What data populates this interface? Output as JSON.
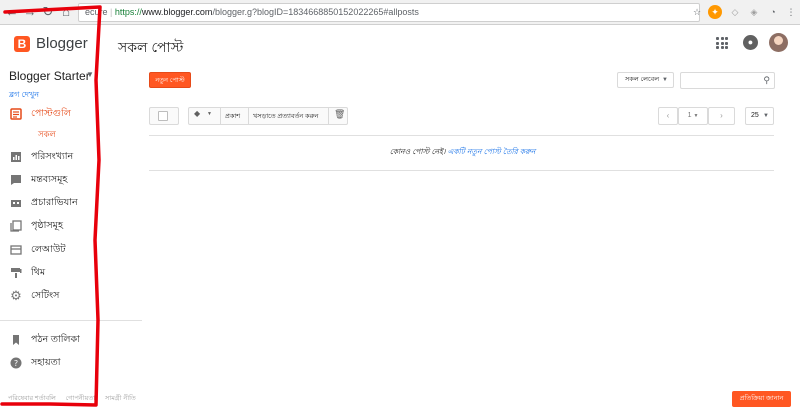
{
  "browser": {
    "secure_label": "ecure",
    "url_scheme": "https://",
    "url_host": "www.blogger.com",
    "url_rest": "/blogger.g?blogID=1834668850152022265#allposts"
  },
  "header": {
    "brand": "Blogger",
    "page_title": "সকল পোস্ট"
  },
  "sidebar": {
    "blog_name": "Blogger Starter",
    "view_blog": "ব্লগ দেখুন",
    "items": [
      {
        "label": "পোস্টগুলি",
        "icon": "posts-icon"
      },
      {
        "label": "পরিসংখ্যান",
        "icon": "stats-icon"
      },
      {
        "label": "মন্তব্যসমূহ",
        "icon": "comments-icon"
      },
      {
        "label": "প্রচারাভিযান",
        "icon": "earnings-icon"
      },
      {
        "label": "পৃষ্ঠাসমূহ",
        "icon": "pages-icon"
      },
      {
        "label": "লেআউট",
        "icon": "layout-icon"
      },
      {
        "label": "থিম",
        "icon": "theme-icon"
      },
      {
        "label": "সেটিংস",
        "icon": "settings-icon"
      },
      {
        "label": "পঠন তালিকা",
        "icon": "reading-list-icon"
      },
      {
        "label": "সহায়তা",
        "icon": "help-icon"
      }
    ],
    "sub_item": "সকল",
    "footer": [
      "পরিষেবার শর্তাবলি",
      "গোপনীয়তা",
      "সামগ্রী নীতি"
    ]
  },
  "main": {
    "new_post": "নতুন পোস্ট",
    "label_filter": "সকল লেবেল",
    "publish": "প্রকাশ",
    "revert_draft": "খসড়াতে প্রত্যাবর্তন করুন",
    "page_number": "1",
    "per_page": "25",
    "empty_text": "কোনও পোস্ট নেই।",
    "empty_link": "একটি নতুন পোস্ট তৈরি করুন",
    "feedback": "প্রতিক্রিয়া জানান"
  },
  "colors": {
    "accent": "#ff5722",
    "annotation": "#e8000b",
    "link": "#1a73e8"
  }
}
